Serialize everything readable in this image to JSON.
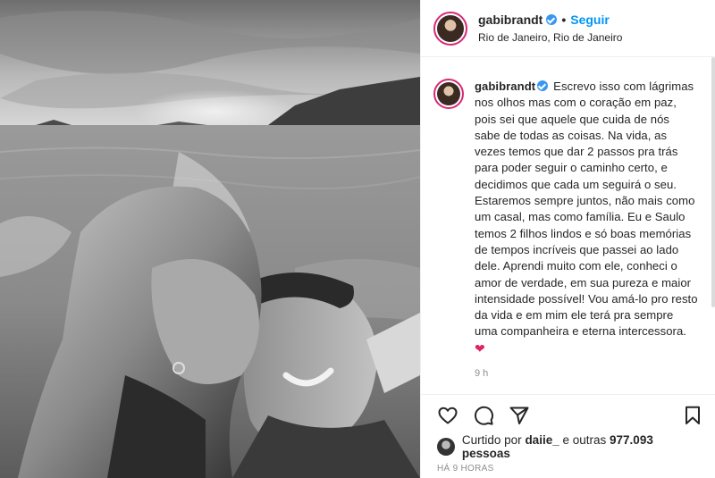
{
  "post": {
    "username": "gabibrandt",
    "follow_label": "Seguir",
    "separator": "•",
    "location": "Rio de Janeiro, Rio de Janeiro",
    "caption": "Escrevo isso com lágrimas nos olhos mas com o coração em paz, pois sei que aquele que cuida de nós sabe de todas as coisas. Na vida, as vezes temos que dar 2 passos pra trás para poder seguir o caminho certo, e decidimos que cada um seguirá o seu. Estaremos sempre juntos, não mais como um casal, mas como família. Eu e Saulo temos 2 filhos lindos e só boas memórias de tempos incríveis que passei ao lado dele. Aprendi muito com ele, conheci o amor de verdade, em sua pureza e maior intensidade possível! Vou amá-lo pro resto da vida e em mim ele terá pra sempre uma companheira e eterna intercessora.",
    "caption_emoji": "❤",
    "caption_time": "9 h",
    "likes_prefix": "Curtido por",
    "likes_user": "daiie_",
    "likes_middle": "e outras",
    "likes_count": "977.093 pessoas",
    "posted_ago": "HÁ 9 HORAS"
  },
  "icons": {
    "verified": "verified-badge-icon",
    "like": "heart-outline-icon",
    "comment": "comment-bubble-icon",
    "share": "paper-plane-icon",
    "save": "bookmark-icon",
    "caption_heart": "red-heart-emoji"
  },
  "colors": {
    "accent": "#0095f6",
    "verified": "#3897f0",
    "secondary_text": "#8e8e8e",
    "heart": "#e0245e",
    "avatar_ring": "#d62976"
  }
}
